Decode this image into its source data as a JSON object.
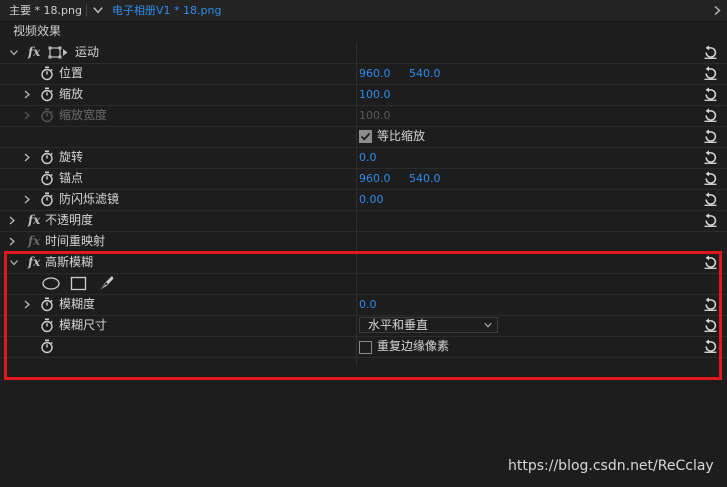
{
  "tabs": {
    "tab1": "主要 * 18.png",
    "tab2": "电子相册V1 * 18.png"
  },
  "panel": {
    "title": "视频效果"
  },
  "icons": {
    "fx": "fx",
    "stopwatch": "stopwatch-icon",
    "reset": "reset-icon",
    "chevron": "chevron-icon"
  },
  "colors": {
    "value_blue": "#2d8ceb",
    "highlight_red": "#e1161e"
  },
  "motion": {
    "label": "运动",
    "position": {
      "label": "位置",
      "x": "960.0",
      "y": "540.0"
    },
    "scale": {
      "label": "缩放",
      "value": "100.0"
    },
    "scale_width": {
      "label": "缩放宽度",
      "value": "100.0"
    },
    "uniform_scale": {
      "label": "等比缩放",
      "checked": true
    },
    "rotation": {
      "label": "旋转",
      "value": "0.0"
    },
    "anchor": {
      "label": "锚点",
      "x": "960.0",
      "y": "540.0"
    },
    "anti_flicker": {
      "label": "防闪烁滤镜",
      "value": "0.00"
    }
  },
  "opacity": {
    "label": "不透明度"
  },
  "time_remap": {
    "label": "时间重映射"
  },
  "gaussian_blur": {
    "label": "高斯模糊",
    "blurriness": {
      "label": "模糊度",
      "value": "0.0"
    },
    "blur_dimensions": {
      "label": "模糊尺寸",
      "value": "水平和垂直"
    },
    "repeat_edge": {
      "label": "重复边缘像素",
      "checked": false
    }
  },
  "watermark": "https://blog.csdn.net/ReCclay"
}
